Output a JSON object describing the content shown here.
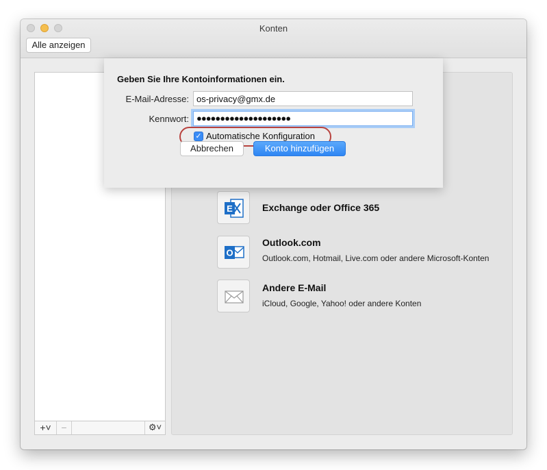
{
  "window": {
    "title": "Konten",
    "show_all_label": "Alle anzeigen"
  },
  "sidebar": {
    "add_label": "+˅",
    "remove_label": "−",
    "gear_label": "⚙˅"
  },
  "accounts": [
    {
      "title": "Exchange oder Office 365",
      "subtitle": "",
      "icon": "exchange-icon",
      "color": "#1e6fc7"
    },
    {
      "title": "Outlook.com",
      "subtitle": "Outlook.com, Hotmail, Live.com oder andere Microsoft-Konten",
      "icon": "outlook-icon",
      "color": "#1e6fc7"
    },
    {
      "title": "Andere E-Mail",
      "subtitle": "iCloud, Google, Yahoo! oder andere Konten",
      "icon": "envelope-icon",
      "color": "#9a9a9a"
    }
  ],
  "sheet": {
    "heading": "Geben Sie Ihre Kontoinformationen ein.",
    "email_label": "E-Mail-Adresse:",
    "email_value": "os-privacy@gmx.de",
    "password_label": "Kennwort:",
    "password_value": "●●●●●●●●●●●●●●●●●●●●",
    "auto_config_label": "Automatische Konfiguration",
    "auto_config_checked": true,
    "cancel_label": "Abbrechen",
    "add_label": "Konto hinzufügen"
  }
}
